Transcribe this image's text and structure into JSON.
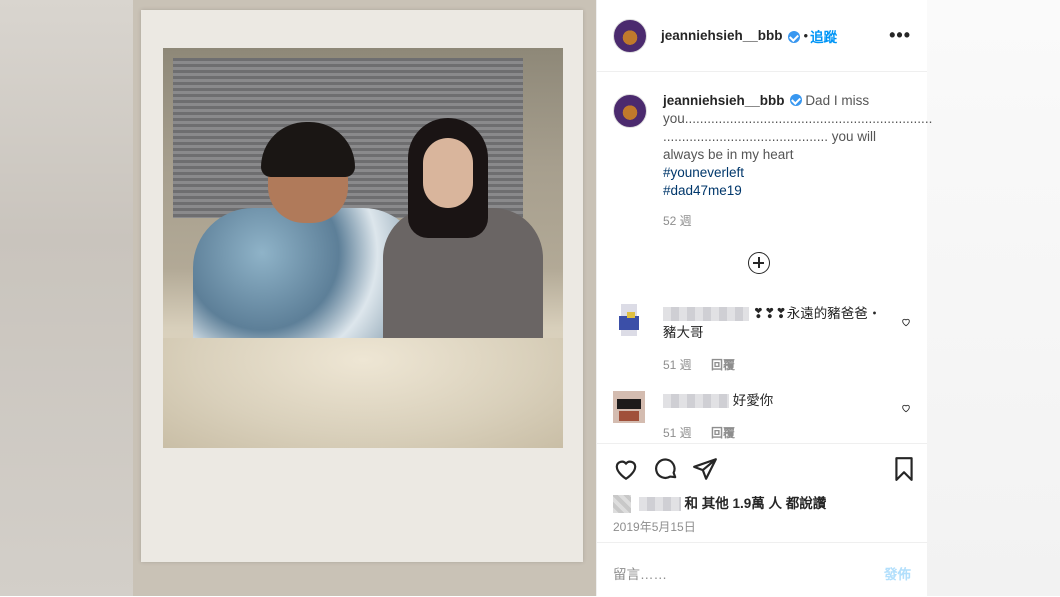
{
  "header": {
    "username": "jeanniehsieh__bbb",
    "separator": "•",
    "follow_label": "追蹤",
    "more_label": "•••"
  },
  "caption": {
    "username": "jeanniehsieh__bbb",
    "text_line1": "Dad I miss",
    "text_line2": "you..................................................................",
    "text_line3": "............................................ you will",
    "text_line4": "always be in my heart",
    "hashtag1": "#youneverleft",
    "hashtag2": "#dad47me19",
    "time": "52 週"
  },
  "comments": [
    {
      "text": "❣❣❣永遠的豬爸爸・豬大哥",
      "time": "51 週",
      "reply": "回覆"
    },
    {
      "text": "好愛你",
      "time": "51 週",
      "reply": "回覆"
    }
  ],
  "likes_text": "和 其他 1.9萬 人 都說讚",
  "date": "2019年5月15日",
  "add_comment_placeholder": "留言……",
  "post_label": "發佈",
  "icons": [
    "heart-icon",
    "comment-icon",
    "share-icon",
    "bookmark-icon",
    "add-circle-icon",
    "verified-icon",
    "more-icon"
  ],
  "colors": {
    "accent": "#0095f6",
    "verified": "#3897f0",
    "text": "#262626",
    "muted": "#8e8e8e"
  }
}
